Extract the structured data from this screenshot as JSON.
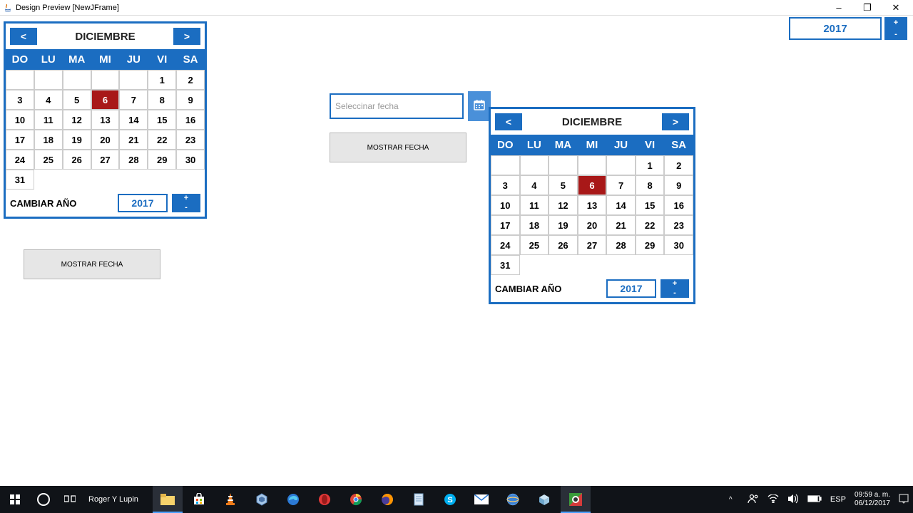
{
  "window": {
    "title": "Design Preview [NewJFrame]",
    "minimize": "–",
    "maximize": "❐",
    "close": "✕"
  },
  "top_year": {
    "value": "2017",
    "plus": "+",
    "minus": "-"
  },
  "calendar1": {
    "prev": "<",
    "next": ">",
    "month": "DICIEMBRE",
    "dow": [
      "DO",
      "LU",
      "MA",
      "MI",
      "JU",
      "VI",
      "SA"
    ],
    "lead_blanks": 5,
    "days_in_month": 31,
    "selected_day": 6,
    "change_year_label": "CAMBIAR AÑO",
    "year": "2017",
    "plus": "+",
    "minus": "-"
  },
  "calendar2": {
    "prev": "<",
    "next": ">",
    "month": "DICIEMBRE",
    "dow": [
      "DO",
      "LU",
      "MA",
      "MI",
      "JU",
      "VI",
      "SA"
    ],
    "lead_blanks": 5,
    "days_in_month": 31,
    "selected_day": 6,
    "change_year_label": "CAMBIAR AÑO",
    "year": "2017",
    "plus": "+",
    "minus": "-"
  },
  "date_picker": {
    "placeholder": "Seleccinar fecha"
  },
  "buttons": {
    "mostrar": "MOSTRAR FECHA"
  },
  "taskbar": {
    "label": "Roger Y Lupin",
    "lang": "ESP",
    "time": "09:59 a. m.",
    "date": "06/12/2017",
    "chevron": "^"
  }
}
